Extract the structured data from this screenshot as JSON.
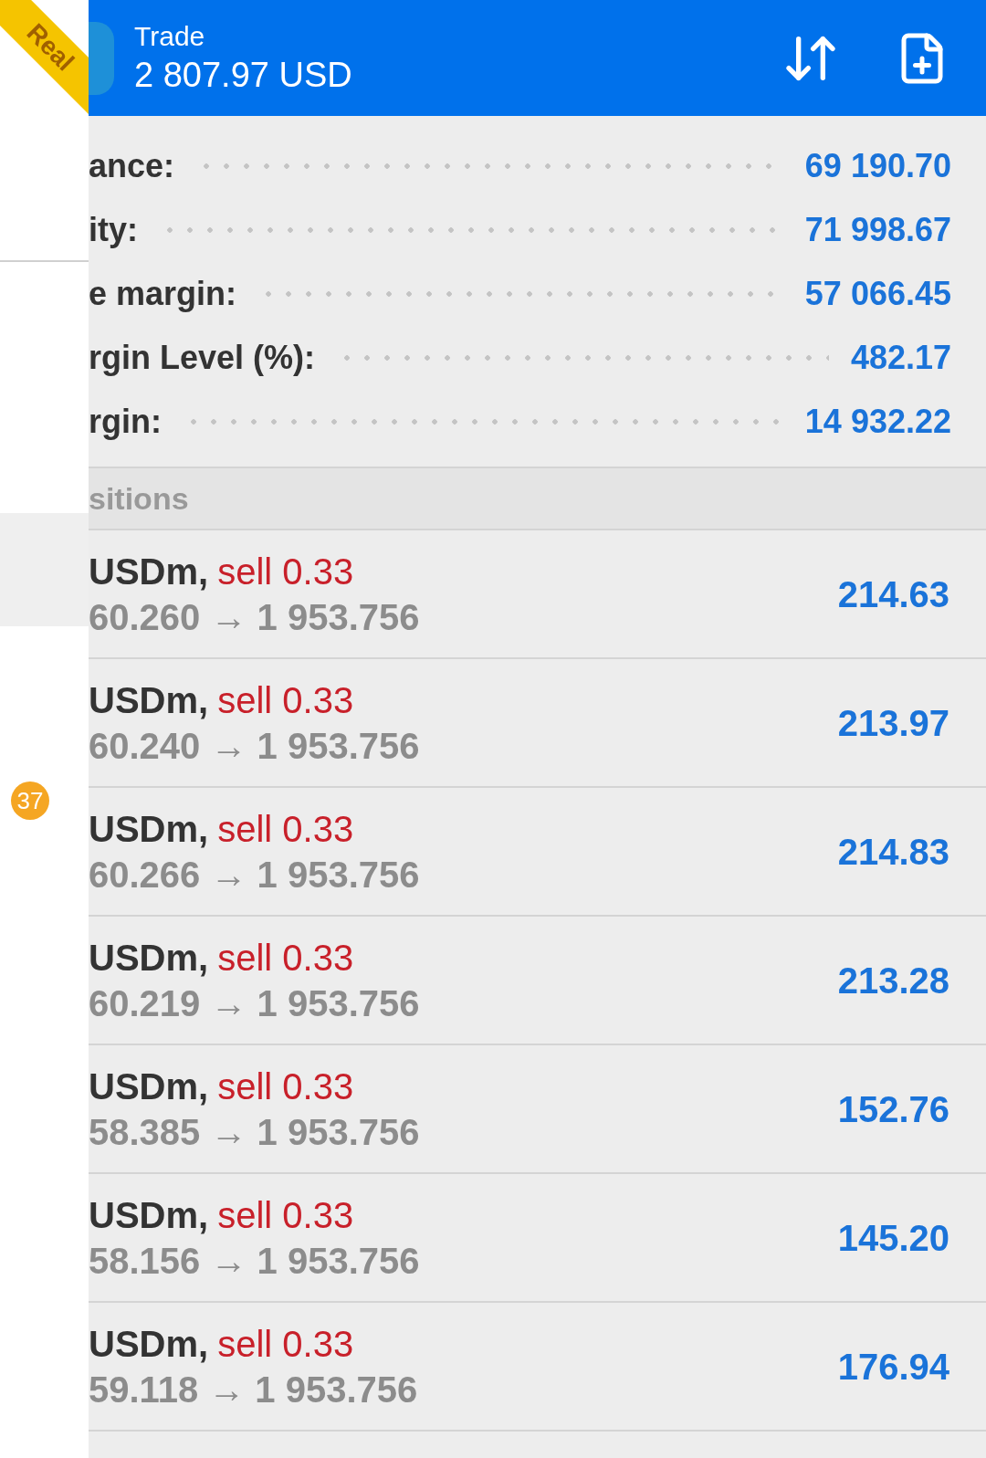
{
  "account_badge": "Real",
  "drawer": {
    "badge": "37"
  },
  "header": {
    "title": "Trade",
    "balance": "2 807.97 USD"
  },
  "summary": [
    {
      "label": "ance:",
      "value": "69 190.70"
    },
    {
      "label": "ity:",
      "value": "71 998.67"
    },
    {
      "label": "e margin:",
      "value": "57 066.45"
    },
    {
      "label": "rgin Level (%):",
      "value": "482.17"
    },
    {
      "label": "rgin:",
      "value": "14 932.22"
    }
  ],
  "positions_header": "sitions",
  "positions": [
    {
      "symbol": "USDm,",
      "side": "sell 0.33",
      "prices": "60.260 → 1 953.756",
      "profit": "214.63"
    },
    {
      "symbol": "USDm,",
      "side": "sell 0.33",
      "prices": "60.240 → 1 953.756",
      "profit": "213.97"
    },
    {
      "symbol": "USDm,",
      "side": "sell 0.33",
      "prices": "60.266 → 1 953.756",
      "profit": "214.83"
    },
    {
      "symbol": "USDm,",
      "side": "sell 0.33",
      "prices": "60.219 → 1 953.756",
      "profit": "213.28"
    },
    {
      "symbol": "USDm,",
      "side": "sell 0.33",
      "prices": "58.385 → 1 953.756",
      "profit": "152.76"
    },
    {
      "symbol": "USDm,",
      "side": "sell 0.33",
      "prices": "58.156 → 1 953.756",
      "profit": "145.20"
    },
    {
      "symbol": "USDm,",
      "side": "sell 0.33",
      "prices": "59.118 → 1 953.756",
      "profit": "176.94"
    }
  ]
}
